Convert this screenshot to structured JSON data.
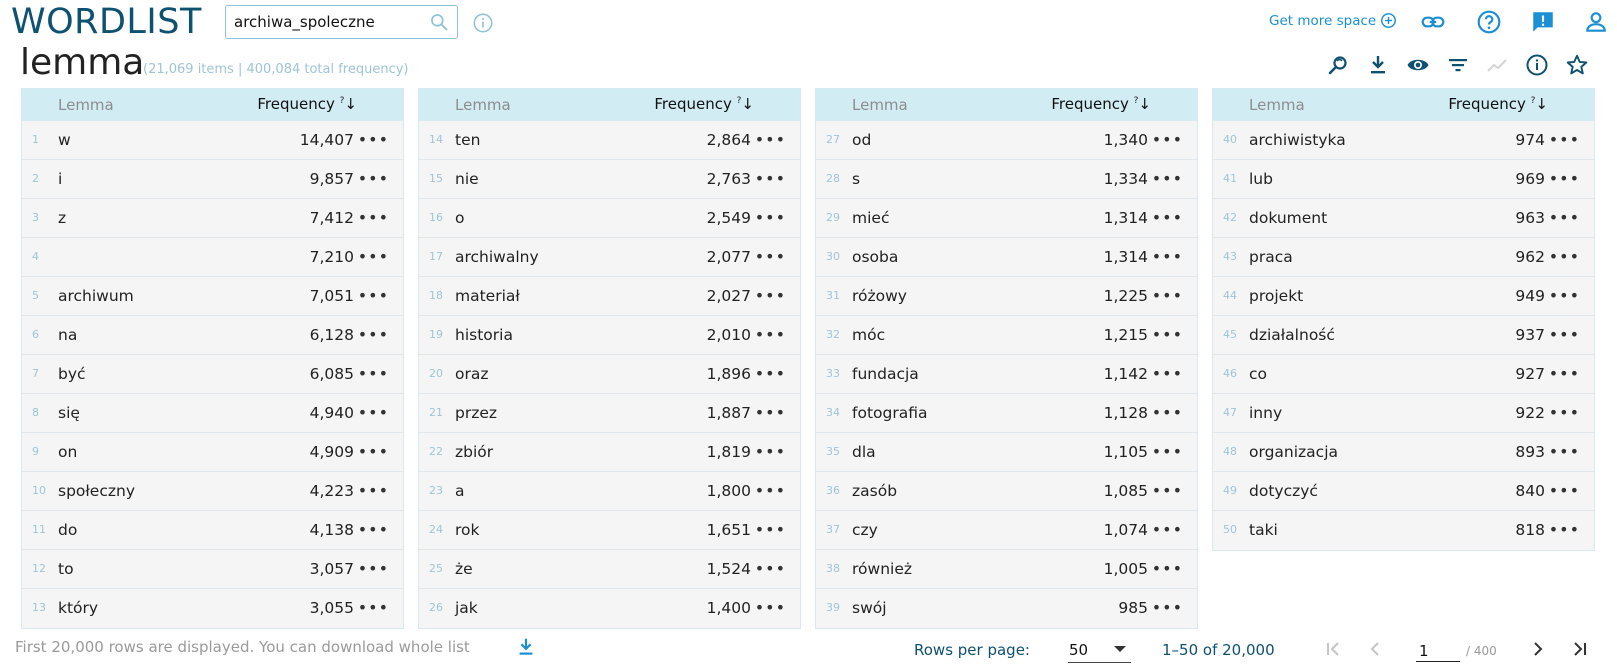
{
  "app": {
    "logo": "WORDLIST"
  },
  "search": {
    "value": "archiwa_spoleczne"
  },
  "top_actions": {
    "more_space": "Get more space"
  },
  "header": {
    "title": "lemma",
    "subtitle": "(21,069 items | 400,084 total frequency)"
  },
  "table": {
    "col_lemma": "Lemma",
    "col_freq": "Frequency",
    "col_freq_mark": "?",
    "sort_arrow": "↓",
    "menu_glyph": "•••",
    "columns": [
      [
        {
          "n": "1",
          "w": "w",
          "f": "14,407"
        },
        {
          "n": "2",
          "w": "i",
          "f": "9,857"
        },
        {
          "n": "3",
          "w": "z",
          "f": "7,412"
        },
        {
          "n": "4",
          "w": "",
          "f": "7,210"
        },
        {
          "n": "5",
          "w": "archiwum",
          "f": "7,051"
        },
        {
          "n": "6",
          "w": "na",
          "f": "6,128"
        },
        {
          "n": "7",
          "w": "być",
          "f": "6,085"
        },
        {
          "n": "8",
          "w": "się",
          "f": "4,940"
        },
        {
          "n": "9",
          "w": "on",
          "f": "4,909"
        },
        {
          "n": "10",
          "w": "społeczny",
          "f": "4,223"
        },
        {
          "n": "11",
          "w": "do",
          "f": "4,138"
        },
        {
          "n": "12",
          "w": "to",
          "f": "3,057"
        },
        {
          "n": "13",
          "w": "który",
          "f": "3,055"
        }
      ],
      [
        {
          "n": "14",
          "w": "ten",
          "f": "2,864"
        },
        {
          "n": "15",
          "w": "nie",
          "f": "2,763"
        },
        {
          "n": "16",
          "w": "o",
          "f": "2,549"
        },
        {
          "n": "17",
          "w": "archiwalny",
          "f": "2,077"
        },
        {
          "n": "18",
          "w": "materiał",
          "f": "2,027"
        },
        {
          "n": "19",
          "w": "historia",
          "f": "2,010"
        },
        {
          "n": "20",
          "w": "oraz",
          "f": "1,896"
        },
        {
          "n": "21",
          "w": "przez",
          "f": "1,887"
        },
        {
          "n": "22",
          "w": "zbiór",
          "f": "1,819"
        },
        {
          "n": "23",
          "w": "a",
          "f": "1,800"
        },
        {
          "n": "24",
          "w": "rok",
          "f": "1,651"
        },
        {
          "n": "25",
          "w": "że",
          "f": "1,524"
        },
        {
          "n": "26",
          "w": "jak",
          "f": "1,400"
        }
      ],
      [
        {
          "n": "27",
          "w": "od",
          "f": "1,340"
        },
        {
          "n": "28",
          "w": "s",
          "f": "1,334"
        },
        {
          "n": "29",
          "w": "mieć",
          "f": "1,314"
        },
        {
          "n": "30",
          "w": "osoba",
          "f": "1,314"
        },
        {
          "n": "31",
          "w": "różowy",
          "f": "1,225"
        },
        {
          "n": "32",
          "w": "móc",
          "f": "1,215"
        },
        {
          "n": "33",
          "w": "fundacja",
          "f": "1,142"
        },
        {
          "n": "34",
          "w": "fotografia",
          "f": "1,128"
        },
        {
          "n": "35",
          "w": "dla",
          "f": "1,105"
        },
        {
          "n": "36",
          "w": "zasób",
          "f": "1,085"
        },
        {
          "n": "37",
          "w": "czy",
          "f": "1,074"
        },
        {
          "n": "38",
          "w": "również",
          "f": "1,005"
        },
        {
          "n": "39",
          "w": "swój",
          "f": "985"
        }
      ],
      [
        {
          "n": "40",
          "w": "archiwistyka",
          "f": "974"
        },
        {
          "n": "41",
          "w": "lub",
          "f": "969"
        },
        {
          "n": "42",
          "w": "dokument",
          "f": "963"
        },
        {
          "n": "43",
          "w": "praca",
          "f": "962"
        },
        {
          "n": "44",
          "w": "projekt",
          "f": "949"
        },
        {
          "n": "45",
          "w": "działalność",
          "f": "937"
        },
        {
          "n": "46",
          "w": "co",
          "f": "927"
        },
        {
          "n": "47",
          "w": "inny",
          "f": "922"
        },
        {
          "n": "48",
          "w": "organizacja",
          "f": "893"
        },
        {
          "n": "49",
          "w": "dotyczyć",
          "f": "840"
        },
        {
          "n": "50",
          "w": "taki",
          "f": "818"
        }
      ]
    ]
  },
  "footer": {
    "note": "First 20,000 rows are displayed. You can download whole list",
    "rows_per_page_label": "Rows per page:",
    "rows_per_page_value": "50",
    "range": "1–50 of 20,000",
    "page": "1",
    "page_total": "/ 400"
  },
  "colors": {
    "brand": "#0e5170",
    "accent": "#1a8fd4",
    "header_bg": "#d2ecf4"
  }
}
